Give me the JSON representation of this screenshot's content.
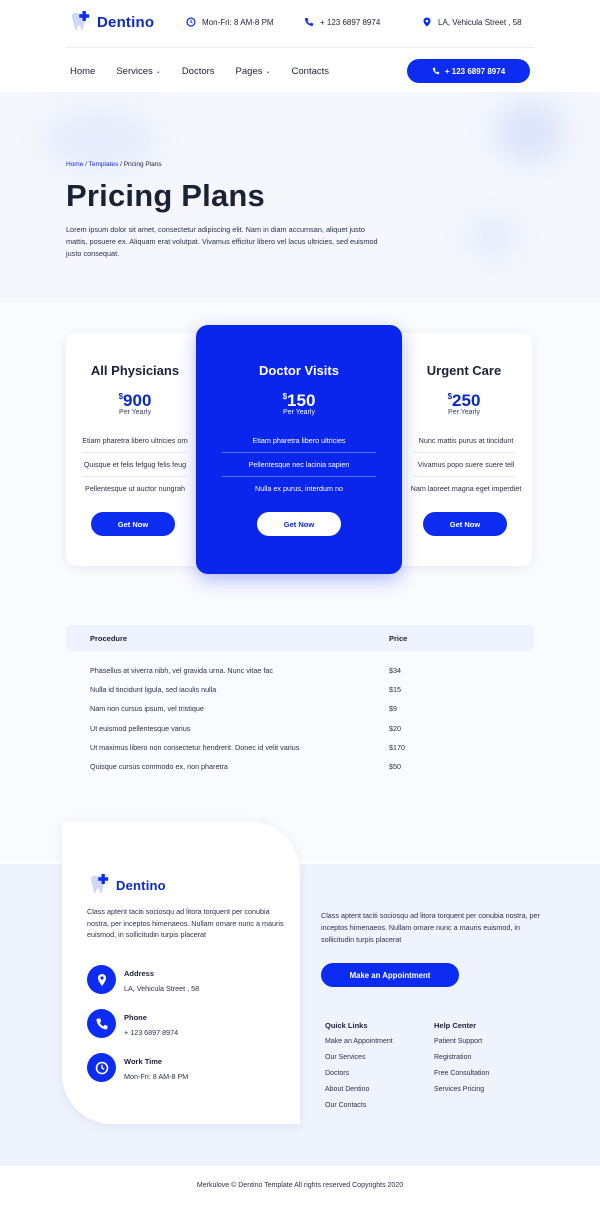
{
  "brand": {
    "name": "Dentino",
    "accent": "#0c2cf1"
  },
  "topbar": {
    "hours": "Mon-Fri: 8 AM-8 PM",
    "phone": "+ 123 6897 8974",
    "address": "LA, Vehicula Street , 58"
  },
  "nav": {
    "items": [
      "Home",
      "Services",
      "Doctors",
      "Pages",
      "Contacts"
    ],
    "call_button": "+ 123 6897 8974"
  },
  "hero": {
    "breadcrumb": {
      "home": "Home",
      "sep1": " / ",
      "templates": "Templates",
      "sep2": " / ",
      "current": "Pricing Plans"
    },
    "title": "Pricing Plans",
    "description": "Lorem ipsum dolor sit amet, consectetur adipiscing elit. Nam in diam accumsan, aliquet justo mattis, posuere ex. Aliquam erat volutpat. Vivamus efficitur libero vel lacus ultricies, sed euismod justo consequat."
  },
  "plans": [
    {
      "title": "All Physicians",
      "currency": "$",
      "price": "900",
      "period": "Per Yearly",
      "features": [
        "Etiam pharetra libero ultricies orn",
        "Quisque et felis fefgug felis feug",
        "Pellentesque ut auctor nungrah"
      ],
      "button": "Get Now"
    },
    {
      "title": "Doctor Visits",
      "currency": "$",
      "price": "150",
      "period": "Per Yearly",
      "features": [
        "Etiam pharetra libero ultricies",
        "Pellentesque nec lacinia sapien",
        "Nulla ex purus, interdum no"
      ],
      "button": "Get Now"
    },
    {
      "title": "Urgent Care",
      "currency": "$",
      "price": "250",
      "period": "Per Yearly",
      "features": [
        "Nunc mattis purus at tincidunt",
        "Vivamus popo suere suere tell",
        "Nam laoreet magna eget imperdiet"
      ],
      "button": "Get Now"
    }
  ],
  "table": {
    "headers": [
      "Procedure",
      "Price"
    ],
    "rows": [
      [
        "Phasellus at viverra nibh, vel gravida urna. Nunc vitae fac",
        "$34"
      ],
      [
        "Nulla id tincidunt ligula, sed iaculis nulla",
        "$15"
      ],
      [
        "Nam non cursus ipsum, vel tristique",
        "$9"
      ],
      [
        "Ut euismod pellentesque varius",
        "$20"
      ],
      [
        "Ut maximus libero non consectetur hendrerit. Donec id velit varius",
        "$170"
      ],
      [
        "Quisque cursus commodo ex, non pharetra",
        "$50"
      ]
    ]
  },
  "footer": {
    "brand": "Dentino",
    "description": "Class aptent taciti sociosqu ad litora torquent per conubia nostra, per inceptos himenaeos. Nullam ornare nunc a mauris euismod, in sollicitudin turpis placerat",
    "contacts": [
      {
        "title": "Address",
        "value": "LA, Vehicula Street , 58",
        "icon": "map-pin-icon"
      },
      {
        "title": "Phone",
        "value": "+ 123 6897 8974",
        "icon": "phone-icon"
      },
      {
        "title": "Work Time",
        "value": "Mon-Fri: 8 AM-8 PM",
        "icon": "clock-icon"
      }
    ],
    "description2": "Class aptent taciti sociosqu ad litora torquent per conubia nostra, per inceptos himenaeos. Nullam ornare nunc a mauris euismod, in sollicitudin turpis placerat",
    "appointment_button": "Make an Appointment",
    "quick_links": {
      "title": "Quick Links",
      "items": [
        "Make an Appointment",
        "Our Services",
        "Doctors",
        "About Dentino",
        "Our Contacts"
      ]
    },
    "help_center": {
      "title": "Help Center",
      "items": [
        "Patient Support",
        "Registration",
        "Free Consultation",
        "Services Pricing"
      ]
    },
    "copyright": "Merkulove © Dentino Template All rights reserved Copyrights 2020"
  }
}
